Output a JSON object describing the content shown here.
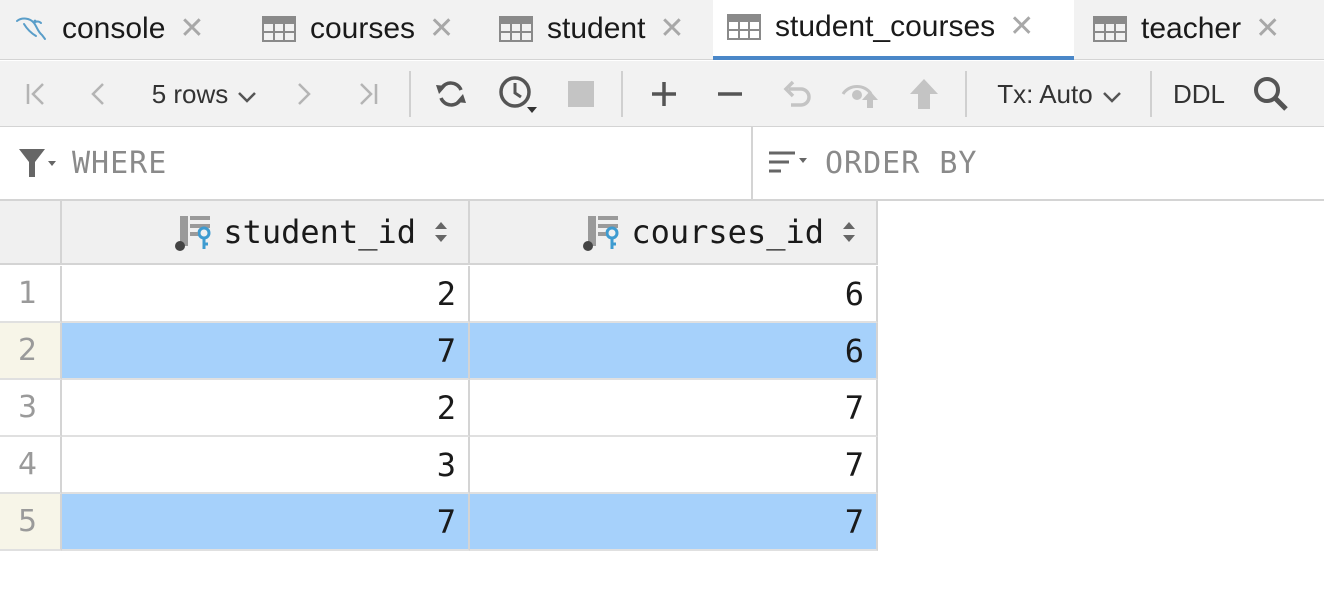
{
  "tabs": [
    {
      "label": "console",
      "icon": "mysql-console-icon",
      "active": false
    },
    {
      "label": "courses",
      "icon": "table-icon",
      "active": false
    },
    {
      "label": "student",
      "icon": "table-icon",
      "active": false
    },
    {
      "label": "student_courses",
      "icon": "table-icon",
      "active": true
    },
    {
      "label": "teacher",
      "icon": "table-icon",
      "active": false
    }
  ],
  "toolbar": {
    "rows_label": "5 rows",
    "tx_label": "Tx: Auto",
    "ddl_label": "DDL"
  },
  "filter": {
    "where_placeholder": "WHERE",
    "order_by_placeholder": "ORDER BY"
  },
  "grid": {
    "columns": [
      "student_id",
      "courses_id"
    ],
    "rows": [
      {
        "num": "1",
        "values": [
          "2",
          "6"
        ],
        "selected": false
      },
      {
        "num": "2",
        "values": [
          "7",
          "6"
        ],
        "selected": true
      },
      {
        "num": "3",
        "values": [
          "2",
          "7"
        ],
        "selected": false
      },
      {
        "num": "4",
        "values": [
          "3",
          "7"
        ],
        "selected": false
      },
      {
        "num": "5",
        "values": [
          "7",
          "7"
        ],
        "selected": true
      }
    ]
  },
  "colors": {
    "accent": "#4a87c8",
    "selection": "#a6d1fb",
    "key_icon": "#3e9bd0"
  }
}
